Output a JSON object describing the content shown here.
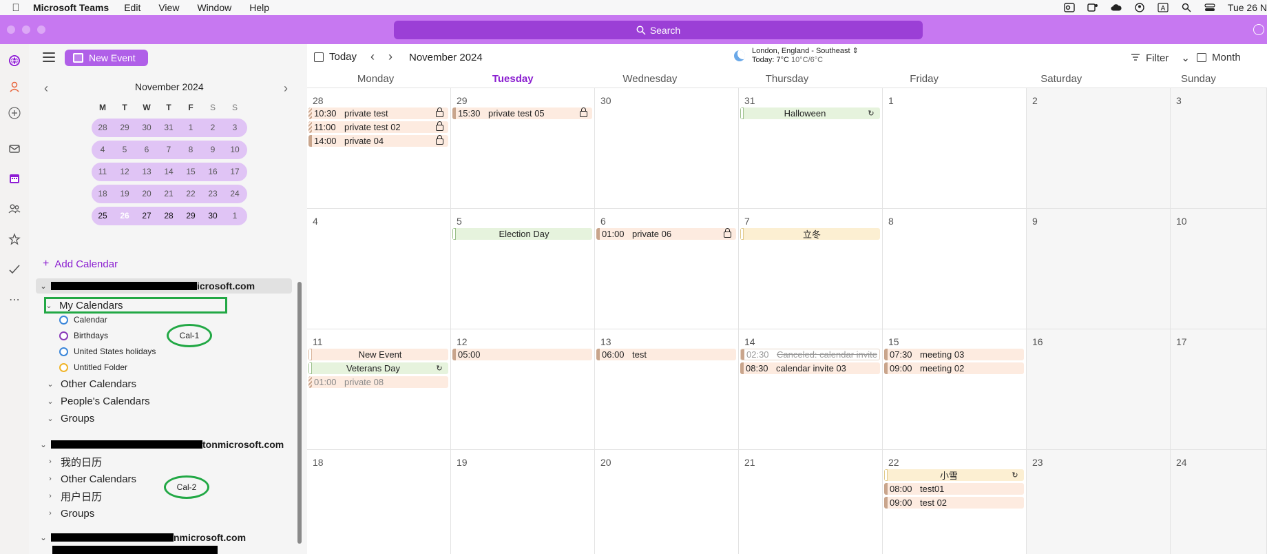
{
  "menubar": {
    "app_name": "Microsoft Teams",
    "menus": [
      "Edit",
      "View",
      "Window",
      "Help"
    ],
    "clock": "Tue 26 N"
  },
  "titlebar": {
    "search_label": "Search"
  },
  "toolbar": {
    "new_event_label": "New Event"
  },
  "mini_calendar": {
    "title": "November 2024",
    "dow": [
      "M",
      "T",
      "W",
      "T",
      "F",
      "S",
      "S"
    ],
    "weeks": [
      [
        "28",
        "29",
        "30",
        "31",
        "1",
        "2",
        "3"
      ],
      [
        "4",
        "5",
        "6",
        "7",
        "8",
        "9",
        "10"
      ],
      [
        "11",
        "12",
        "13",
        "14",
        "15",
        "16",
        "17"
      ],
      [
        "18",
        "19",
        "20",
        "21",
        "22",
        "23",
        "24"
      ],
      [
        "25",
        "26",
        "27",
        "28",
        "29",
        "30",
        "1"
      ]
    ],
    "today": "26"
  },
  "sidebar": {
    "add_calendar_label": "Add Calendar",
    "account1_suffix": "icrosoft.com",
    "my_calendars_label": "My Calendars",
    "calendars": [
      {
        "name": "Calendar",
        "color": "#3a86d9"
      },
      {
        "name": "Birthdays",
        "color": "#8a3ab9"
      },
      {
        "name": "United States holidays",
        "color": "#3a86d9"
      },
      {
        "name": "Untitled Folder",
        "color": "#f0b429"
      }
    ],
    "group1": [
      "Other Calendars",
      "People's Calendars",
      "Groups"
    ],
    "account2_suffix": "tonmicrosoft.com",
    "group2": [
      "我的日历",
      "Other Calendars",
      "用户日历",
      "Groups"
    ],
    "account3_suffix": "nmicrosoft.com",
    "annotation1": "Cal-1",
    "annotation2": "Cal-2"
  },
  "calendar_header": {
    "today_label": "Today",
    "month_title": "November 2024",
    "weather_location": "London, England - Southeast",
    "weather_today": "Today: 7°C",
    "weather_range": "10°C/6°C",
    "filter_label": "Filter",
    "view_label": "Month"
  },
  "calendar": {
    "weekdays": [
      "Monday",
      "Tuesday",
      "Wednesday",
      "Thursday",
      "Friday",
      "Saturday",
      "Sunday"
    ],
    "today_weekday_index": 1,
    "weeks": [
      [
        {
          "day": "28",
          "events": [
            {
              "time": "10:30",
              "title": "private test",
              "icon": "lock",
              "bar": "hatch"
            },
            {
              "time": "11:00",
              "title": "private test 02",
              "icon": "lock",
              "bar": "hatch"
            },
            {
              "time": "14:00",
              "title": "private 04",
              "icon": "lock",
              "bar": "solid"
            }
          ]
        },
        {
          "day": "29",
          "events": [
            {
              "time": "15:30",
              "title": "private test 05",
              "icon": "lock",
              "bar": "solid"
            }
          ]
        },
        {
          "day": "30",
          "events": []
        },
        {
          "day": "31",
          "events": [
            {
              "allday": true,
              "style": "green",
              "title": "Halloween",
              "icon": "repeat"
            }
          ]
        },
        {
          "day": "1",
          "events": []
        },
        {
          "day": "2",
          "events": []
        },
        {
          "day": "3",
          "events": []
        }
      ],
      [
        {
          "day": "4",
          "events": []
        },
        {
          "day": "5",
          "events": [
            {
              "allday": true,
              "style": "green",
              "title": "Election Day"
            }
          ]
        },
        {
          "day": "6",
          "events": [
            {
              "time": "01:00",
              "title": "private 06",
              "icon": "lock",
              "bar": "solid"
            }
          ]
        },
        {
          "day": "7",
          "events": [
            {
              "allday": true,
              "style": "yellow",
              "title": "立冬"
            }
          ]
        },
        {
          "day": "8",
          "events": []
        },
        {
          "day": "9",
          "events": []
        },
        {
          "day": "10",
          "events": []
        }
      ],
      [
        {
          "day": "11",
          "events": [
            {
              "allday": true,
              "style": "allday-peach",
              "title": "New Event"
            },
            {
              "allday": true,
              "style": "green",
              "title": "Veterans Day",
              "icon": "repeat"
            },
            {
              "time": "01:00",
              "title": "private 08",
              "bar": "hatch",
              "dim": true
            }
          ]
        },
        {
          "day": "12",
          "events": [
            {
              "time": "05:00",
              "title": "",
              "bar": "solid"
            }
          ]
        },
        {
          "day": "13",
          "events": [
            {
              "time": "06:00",
              "title": "test",
              "bar": "solid"
            }
          ]
        },
        {
          "day": "14",
          "events": [
            {
              "time": "02:30",
              "title": "Canceled: calendar invite",
              "style": "outline"
            },
            {
              "time": "08:30",
              "title": "calendar invite 03",
              "bar": "solid"
            }
          ]
        },
        {
          "day": "15",
          "events": [
            {
              "time": "07:30",
              "title": "meeting 03",
              "bar": "solid"
            },
            {
              "time": "09:00",
              "title": "meeting 02",
              "bar": "solid"
            }
          ]
        },
        {
          "day": "16",
          "events": []
        },
        {
          "day": "17",
          "events": []
        }
      ],
      [
        {
          "day": "18",
          "events": []
        },
        {
          "day": "19",
          "events": []
        },
        {
          "day": "20",
          "events": []
        },
        {
          "day": "21",
          "events": []
        },
        {
          "day": "22",
          "events": [
            {
              "allday": true,
              "style": "yellow",
              "title": "小雪",
              "icon": "repeat"
            },
            {
              "time": "08:00",
              "title": "test01",
              "bar": "solid"
            },
            {
              "time": "09:00",
              "title": "test 02",
              "bar": "solid"
            }
          ]
        },
        {
          "day": "23",
          "events": []
        },
        {
          "day": "24",
          "events": []
        }
      ]
    ]
  }
}
